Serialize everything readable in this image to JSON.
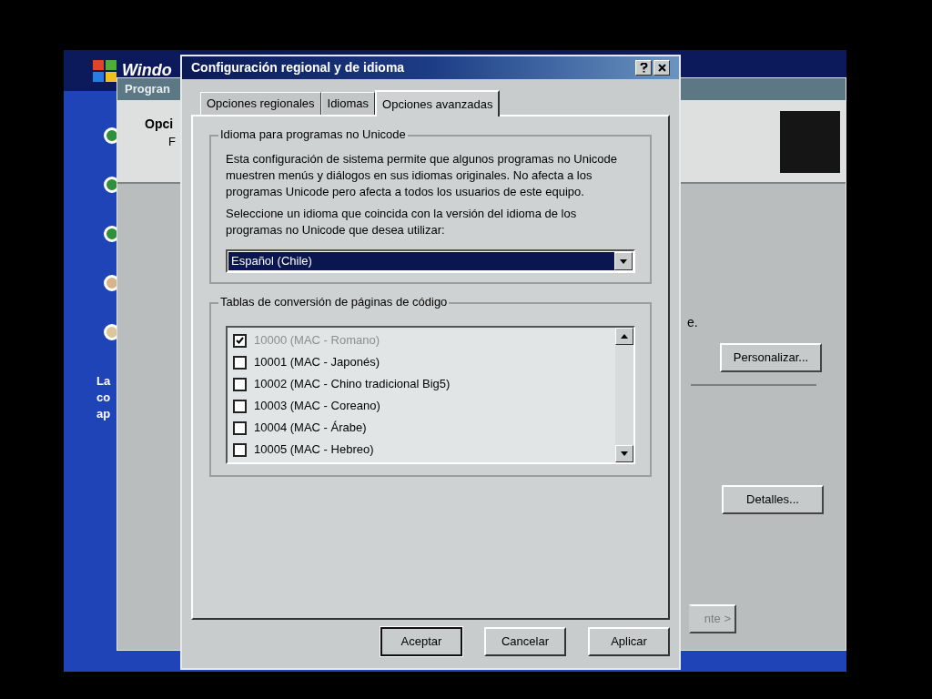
{
  "desktop": {
    "logo_text": "Windo",
    "steps": [
      {
        "color": "#2f8f3a"
      },
      {
        "color": "#2f8f3a"
      },
      {
        "color": "#2f8f3a"
      },
      {
        "color": "#d8b48a"
      },
      {
        "color": "#d8c89a"
      }
    ],
    "side_text": [
      "La",
      "co",
      "ap"
    ]
  },
  "back_window": {
    "title": "Progran",
    "heading": "Opci",
    "subheading": "F",
    "fragment": "e.",
    "buttons": [
      "Personalizar...",
      "Detalles..."
    ],
    "nav_button": "nte >"
  },
  "dialog": {
    "title": "Configuración regional y de idioma",
    "tabs": [
      {
        "label": "Opciones regionales",
        "selected": false
      },
      {
        "label": "Idiomas",
        "selected": false
      },
      {
        "label": "Opciones avanzadas",
        "selected": true
      }
    ],
    "unicode_group": {
      "title": "Idioma para programas no Unicode",
      "description": "Esta configuración de sistema permite que algunos programas no Unicode muestren menús y diálogos en sus idiomas originales. No afecta a los programas Unicode pero afecta a todos los usuarios de este equipo.",
      "prompt": "Seleccione un idioma que coincida con la versión del idioma de los programas no Unicode que desea utilizar:",
      "language": "Español (Chile)"
    },
    "codepage_group": {
      "title": "Tablas de conversión de páginas de código",
      "items": [
        {
          "label": "10000 (MAC - Romano)",
          "checked": true,
          "disabled": true
        },
        {
          "label": "10001 (MAC - Japonés)",
          "checked": false,
          "disabled": false
        },
        {
          "label": "10002 (MAC - Chino tradicional Big5)",
          "checked": false,
          "disabled": false
        },
        {
          "label": "10003 (MAC - Coreano)",
          "checked": false,
          "disabled": false
        },
        {
          "label": "10004 (MAC - Árabe)",
          "checked": false,
          "disabled": false
        },
        {
          "label": "10005 (MAC - Hebreo)",
          "checked": false,
          "disabled": false
        }
      ]
    },
    "buttons": [
      {
        "label": "Aceptar",
        "default": true
      },
      {
        "label": "Cancelar",
        "default": false
      },
      {
        "label": "Aplicar",
        "default": false
      }
    ]
  }
}
